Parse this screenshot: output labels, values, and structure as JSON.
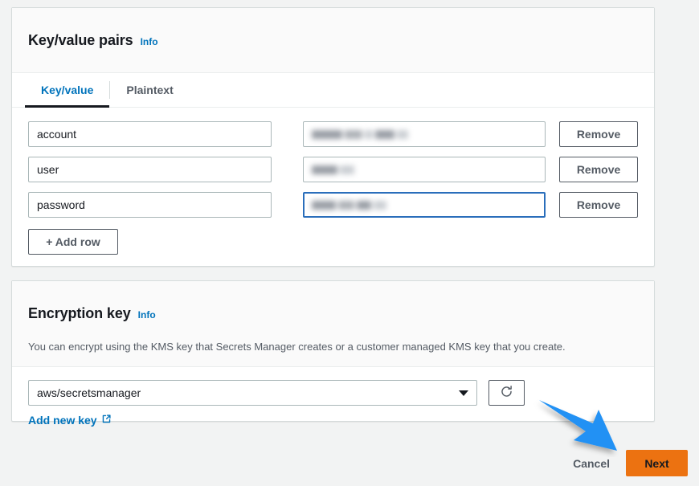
{
  "key_value_panel": {
    "title": "Key/value pairs",
    "info_label": "Info",
    "tabs": [
      {
        "label": "Key/value",
        "active": true
      },
      {
        "label": "Plaintext",
        "active": false
      }
    ],
    "rows": [
      {
        "key": "account",
        "value": "",
        "value_redacted": true,
        "focused": false,
        "remove_label": "Remove"
      },
      {
        "key": "user",
        "value": "",
        "value_redacted": true,
        "focused": false,
        "remove_label": "Remove"
      },
      {
        "key": "password",
        "value": "",
        "value_redacted": true,
        "focused": true,
        "remove_label": "Remove"
      }
    ],
    "add_row_label": "+ Add row"
  },
  "encryption_panel": {
    "title": "Encryption key",
    "info_label": "Info",
    "description": "You can encrypt using the KMS key that Secrets Manager creates or a customer managed KMS key that you create.",
    "selected_key": "aws/secretsmanager",
    "refresh_icon": "refresh-icon",
    "add_new_key_label": "Add new key",
    "external_link_icon": "external-link-icon"
  },
  "footer": {
    "cancel_label": "Cancel",
    "next_label": "Next"
  },
  "annotation": {
    "type": "arrow",
    "points_to": "next-button",
    "color": "#2291F4"
  },
  "colors": {
    "accent_link": "#0073bb",
    "focus_border": "#2a6ebb",
    "primary_button": "#ec7211",
    "page_background": "#f2f3f3",
    "panel_background": "#ffffff",
    "panel_header_background": "#fafafa"
  }
}
